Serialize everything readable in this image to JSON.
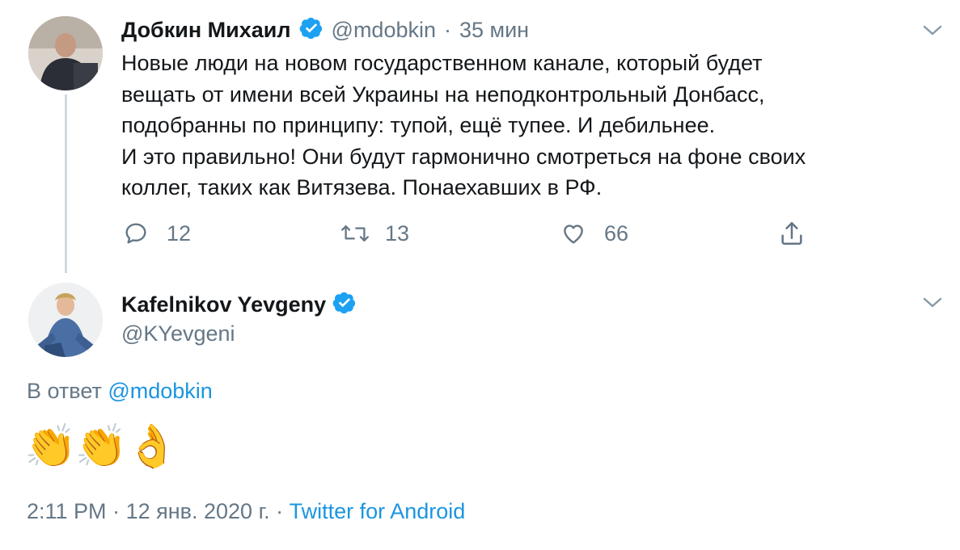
{
  "tweet1": {
    "author_name": "Добкин Михаил",
    "author_handle": "@mdobkin",
    "separator": "·",
    "time_ago": "35 мин",
    "text": "Новые люди на новом государственном канале, который будет\nвещать от имени всей Украины на неподконтрольный Донбасс,\nподобранны по принципу: тупой, ещё тупее. И дебильнее.\nИ это правильно! Они будут гармонично смотреться на фоне своих\nколлег, таких как Витязева. Понаехавших в РФ.",
    "replies": "12",
    "retweets": "13",
    "likes": "66",
    "icons": {
      "reply": "reply-icon",
      "retweet": "retweet-icon",
      "like": "heart-icon",
      "share": "share-icon",
      "menu": "chevron-down-icon",
      "verified": "verified-badge-icon"
    }
  },
  "tweet2": {
    "author_name": "Kafelnikov Yevgeny",
    "author_handle": "@KYevgeni",
    "reply_prefix": "В ответ",
    "reply_to_handle": "@mdobkin",
    "emojis": "👏👏👌",
    "time": "2:11 PM",
    "date": "12 янв. 2020 г.",
    "dot": "·",
    "source": "Twitter for Android"
  },
  "colors": {
    "accent": "#1b95e0",
    "muted": "#657786",
    "text": "#14171a",
    "verified": "#1da1f2"
  }
}
